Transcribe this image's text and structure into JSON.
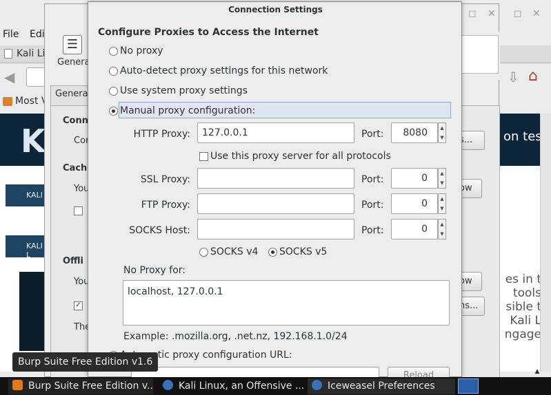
{
  "browser": {
    "menu": [
      "File",
      "Edi"
    ],
    "tab_label": "Kali Li",
    "bookmark_label": "Most V",
    "banner_logo": "K",
    "banner_text": "on tes",
    "nav_strip_1": "KALI",
    "nav_strip_2": "KALI L",
    "side_text": [
      "es in t",
      "tools",
      "sible t",
      "Kali L",
      "ngage"
    ]
  },
  "prefs": {
    "general_label": "Genera",
    "tab_general": "Genera",
    "fragments": {
      "conn": "Conn",
      "con": "Cor",
      "cach": "Cach",
      "you1": "You",
      "offli": "Offli",
      "you2": "You",
      "the": "The"
    },
    "button_fragments": {
      "settings": "s...",
      "clear_now_1": "ow",
      "clear_now_2": "ow",
      "exceptions": "ns..."
    }
  },
  "dialog": {
    "title": "Connection Settings",
    "heading": "Configure Proxies to Access the Internet",
    "options": {
      "no_proxy": "No proxy",
      "auto_detect": "Auto-detect proxy settings for this network",
      "system": "Use system proxy settings",
      "manual": "Manual proxy configuration:",
      "auto_config_url": "Automatic proxy configuration URL:"
    },
    "http": {
      "label": "HTTP Proxy:",
      "value": "127.0.0.1",
      "port_label": "Port:",
      "port": "8080"
    },
    "use_for_all": "Use this proxy server for all protocols",
    "ssl": {
      "label": "SSL Proxy:",
      "value": "",
      "port_label": "Port:",
      "port": "0"
    },
    "ftp": {
      "label": "FTP Proxy:",
      "value": "",
      "port_label": "Port:",
      "port": "0"
    },
    "socks": {
      "label": "SOCKS Host:",
      "value": "",
      "port_label": "Port:",
      "port": "0"
    },
    "socks_v4": "SOCKS v4",
    "socks_v5": "SOCKS v5",
    "no_proxy_for_label": "No Proxy for:",
    "no_proxy_for_value": "localhost, 127.0.0.1",
    "example": "Example: .mozilla.org, .net.nz, 192.168.1.0/24",
    "reload_label": "Reload",
    "selected_option": "manual",
    "selected_socks": "v5"
  },
  "tooltip": "Burp Suite Free Edition v1.6",
  "taskbar": [
    {
      "label": "Burp Suite Free Edition v...",
      "icon": "burp-icon",
      "color": "#e07b1a"
    },
    {
      "label": "Kali Linux, an Offensive ...",
      "icon": "iceweasel-icon",
      "color": "#3b6fb6"
    },
    {
      "label": "Iceweasel Preferences",
      "icon": "iceweasel-icon",
      "color": "#3b6fb6"
    }
  ],
  "colors": {
    "highlight": "#dfe7f2",
    "banner": "#0d2538",
    "taskbar": "#111111"
  }
}
